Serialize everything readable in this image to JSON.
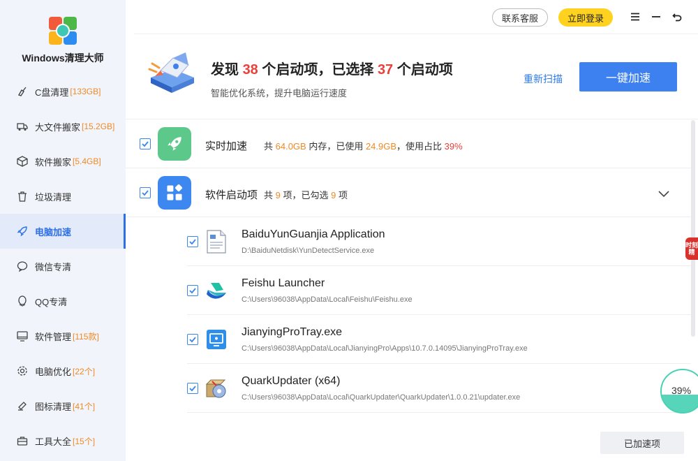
{
  "app": {
    "title": "Windows清理大师"
  },
  "sidebar": {
    "items": [
      {
        "label": "C盘清理",
        "count": "[133GB]"
      },
      {
        "label": "大文件搬家",
        "count": "[15.2GB]"
      },
      {
        "label": "软件搬家",
        "count": "[5.4GB]"
      },
      {
        "label": "垃圾清理",
        "count": ""
      },
      {
        "label": "电脑加速",
        "count": "",
        "active": true
      },
      {
        "label": "微信专清",
        "count": ""
      },
      {
        "label": "QQ专清",
        "count": ""
      },
      {
        "label": "软件管理",
        "count": "[115款]"
      },
      {
        "label": "电脑优化",
        "count": "[22个]"
      },
      {
        "label": "图标清理",
        "count": "[41个]"
      },
      {
        "label": "工具大全",
        "count": "[15个]"
      }
    ]
  },
  "topbar": {
    "service_label": "联系客服",
    "login_label": "立即登录"
  },
  "banner": {
    "h_pre": "发现 ",
    "found": "38",
    "h_mid": " 个启动项，已选择 ",
    "selected": "37",
    "h_post": " 个启动项",
    "subtitle": "智能优化系统，提升电脑运行速度",
    "rescan_label": "重新扫描",
    "boost_label": "一键加速"
  },
  "realtime": {
    "title": "实时加速",
    "p1": "共 ",
    "total": "64.0GB",
    "p2": " 内存，已使用 ",
    "used": "24.9GB",
    "p3": "，使用占比 ",
    "ratio": "39%"
  },
  "startup": {
    "title": "软件启动项",
    "p1": "共 ",
    "total": "9",
    "p2": " 项，已勾选 ",
    "checked": "9",
    "p3": " 项"
  },
  "items": [
    {
      "name": "BaiduYunGuanjia Application",
      "path": "D:\\BaiduNetdisk\\YunDetectService.exe",
      "icon": "document-icon"
    },
    {
      "name": "Feishu Launcher",
      "path": "C:\\Users\\96038\\AppData\\Local\\Feishu\\Feishu.exe",
      "icon": "feishu-icon"
    },
    {
      "name": "JianyingProTray.exe",
      "path": "C:\\Users\\96038\\AppData\\Local\\JianyingPro\\Apps\\10.7.0.14095\\JianyingProTray.exe",
      "icon": "monitor-icon"
    },
    {
      "name": "QuarkUpdater (x64)",
      "path": "C:\\Users\\96038\\AppData\\Local\\QuarkUpdater\\QuarkUpdater\\1.0.0.21\\updater.exe",
      "icon": "installer-icon"
    }
  ],
  "side_tag": "时刻精",
  "memory_ring": {
    "label": "39%",
    "fill_fraction": 0.39
  },
  "boosted_label": "已加速项",
  "colors": {
    "accent": "#3d80f0",
    "highlight": "#e8403a",
    "count": "#f08a24",
    "login": "#ffd21f"
  }
}
